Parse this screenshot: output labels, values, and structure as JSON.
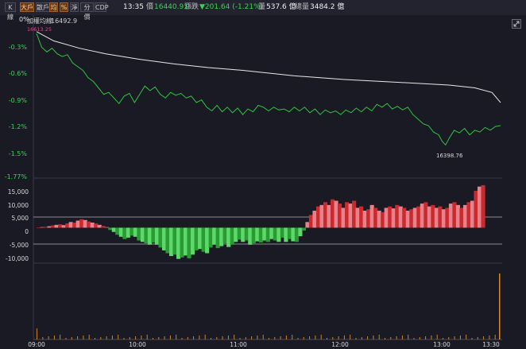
{
  "toolbar": {
    "buttons": [
      {
        "label": "K線",
        "active": false
      },
      {
        "label": "大戶",
        "active": true
      },
      {
        "label": "散戶",
        "active": false
      },
      {
        "label": "均",
        "active": true
      },
      {
        "label": "%",
        "active": true
      },
      {
        "label": "淨",
        "active": false
      },
      {
        "label": "分價",
        "active": false
      },
      {
        "label": "CDP",
        "active": false
      }
    ],
    "time": "13:35",
    "price_label": "價",
    "price": "16440.91",
    "change_label": "漲跌",
    "change": "▼201.64 (-1.21%)",
    "volume_label": "量",
    "volume": "537.6 億",
    "total_label": "總量",
    "total": "3484.2 億"
  },
  "price_panel": {
    "legend_name": "加權均線",
    "legend_value": "16492.9",
    "high_label": "16613.25",
    "low_label": "16398.76",
    "zero_label": "0%",
    "y_ticks": [
      "-0.3%",
      "-0.6%",
      "-0.9%",
      "-1.2%",
      "-1.5%",
      "-1.77%"
    ]
  },
  "flow_panel": {
    "y_ticks": [
      "15,000",
      "10,000",
      "5,000",
      "0",
      "-5,000",
      "-10,000"
    ]
  },
  "x_axis": {
    "ticks": [
      "09:00",
      "10:00",
      "11:00",
      "12:00",
      "13:00",
      "13:30"
    ]
  },
  "chart_data": {
    "type": "line",
    "title": "",
    "x_domain_minutes": [
      0,
      270
    ],
    "price_ylim_pct": [
      0,
      -1.77
    ],
    "average_line_pct": [
      [
        0,
        -0.18
      ],
      [
        10,
        -0.28
      ],
      [
        25,
        -0.36
      ],
      [
        40,
        -0.42
      ],
      [
        60,
        -0.48
      ],
      [
        80,
        -0.53
      ],
      [
        100,
        -0.57
      ],
      [
        120,
        -0.6
      ],
      [
        150,
        -0.66
      ],
      [
        180,
        -0.7
      ],
      [
        210,
        -0.73
      ],
      [
        240,
        -0.76
      ],
      [
        255,
        -0.79
      ],
      [
        265,
        -0.84
      ],
      [
        270,
        -0.95
      ]
    ],
    "index_line_pct": [
      [
        0,
        -0.2
      ],
      [
        3,
        -0.35
      ],
      [
        6,
        -0.4
      ],
      [
        9,
        -0.36
      ],
      [
        12,
        -0.42
      ],
      [
        15,
        -0.45
      ],
      [
        18,
        -0.43
      ],
      [
        21,
        -0.52
      ],
      [
        24,
        -0.56
      ],
      [
        27,
        -0.6
      ],
      [
        30,
        -0.68
      ],
      [
        33,
        -0.72
      ],
      [
        36,
        -0.79
      ],
      [
        39,
        -0.86
      ],
      [
        42,
        -0.84
      ],
      [
        45,
        -0.9
      ],
      [
        48,
        -0.96
      ],
      [
        51,
        -0.88
      ],
      [
        54,
        -0.85
      ],
      [
        57,
        -0.95
      ],
      [
        60,
        -0.86
      ],
      [
        63,
        -0.77
      ],
      [
        66,
        -0.82
      ],
      [
        69,
        -0.78
      ],
      [
        72,
        -0.86
      ],
      [
        75,
        -0.9
      ],
      [
        78,
        -0.84
      ],
      [
        81,
        -0.87
      ],
      [
        84,
        -0.85
      ],
      [
        87,
        -0.9
      ],
      [
        90,
        -0.88
      ],
      [
        93,
        -0.95
      ],
      [
        96,
        -0.92
      ],
      [
        99,
        -1.0
      ],
      [
        102,
        -1.04
      ],
      [
        105,
        -0.98
      ],
      [
        108,
        -1.05
      ],
      [
        111,
        -1.0
      ],
      [
        114,
        -1.06
      ],
      [
        117,
        -1.01
      ],
      [
        120,
        -1.08
      ],
      [
        123,
        -1.02
      ],
      [
        126,
        -1.05
      ],
      [
        129,
        -0.98
      ],
      [
        132,
        -1.0
      ],
      [
        135,
        -1.04
      ],
      [
        138,
        -1.0
      ],
      [
        141,
        -1.03
      ],
      [
        144,
        -1.02
      ],
      [
        147,
        -1.05
      ],
      [
        150,
        -1.0
      ],
      [
        153,
        -1.04
      ],
      [
        156,
        -1.0
      ],
      [
        159,
        -1.06
      ],
      [
        162,
        -1.02
      ],
      [
        165,
        -1.08
      ],
      [
        168,
        -1.03
      ],
      [
        171,
        -1.06
      ],
      [
        174,
        -1.04
      ],
      [
        177,
        -1.08
      ],
      [
        180,
        -1.03
      ],
      [
        183,
        -1.06
      ],
      [
        186,
        -1.01
      ],
      [
        189,
        -1.05
      ],
      [
        192,
        -1.0
      ],
      [
        195,
        -1.04
      ],
      [
        198,
        -0.97
      ],
      [
        201,
        -1.0
      ],
      [
        204,
        -0.96
      ],
      [
        207,
        -1.02
      ],
      [
        210,
        -0.99
      ],
      [
        213,
        -1.03
      ],
      [
        216,
        -1.0
      ],
      [
        219,
        -1.08
      ],
      [
        222,
        -1.13
      ],
      [
        225,
        -1.18
      ],
      [
        228,
        -1.2
      ],
      [
        231,
        -1.27
      ],
      [
        234,
        -1.3
      ],
      [
        236,
        -1.37
      ],
      [
        238,
        -1.41
      ],
      [
        240,
        -1.34
      ],
      [
        243,
        -1.25
      ],
      [
        246,
        -1.28
      ],
      [
        249,
        -1.23
      ],
      [
        252,
        -1.3
      ],
      [
        255,
        -1.25
      ],
      [
        258,
        -1.27
      ],
      [
        261,
        -1.22
      ],
      [
        264,
        -1.25
      ],
      [
        267,
        -1.21
      ],
      [
        270,
        -1.2
      ]
    ],
    "flow_ylim": [
      -12500,
      17500
    ],
    "flow_values": [
      0,
      200,
      300,
      500,
      800,
      1000,
      1200,
      900,
      1500,
      2000,
      1800,
      2500,
      3000,
      2700,
      2200,
      1800,
      1500,
      1000,
      600,
      200,
      -800,
      -1500,
      -2500,
      -3200,
      -4000,
      -3500,
      -2800,
      -3200,
      -4500,
      -5000,
      -5500,
      -6000,
      -5200,
      -6000,
      -7000,
      -8000,
      -9000,
      -10000,
      -9500,
      -11000,
      -10500,
      -9800,
      -10800,
      -9500,
      -8000,
      -7500,
      -8500,
      -9000,
      -7000,
      -6000,
      -7200,
      -6500,
      -5500,
      -6800,
      -6000,
      -5000,
      -4200,
      -5000,
      -4500,
      -6000,
      -5500,
      -4800,
      -5200,
      -4500,
      -5000,
      -4000,
      -4500,
      -5000,
      -3500,
      -5000,
      -4000,
      -4800,
      -5000,
      -3000,
      -1000,
      2000,
      4500,
      6000,
      7500,
      8000,
      9000,
      8000,
      10000,
      9500,
      8500,
      7000,
      9000,
      8500,
      9500,
      7000,
      7500,
      6000,
      6500,
      8000,
      7000,
      6000,
      5500,
      7000,
      7500,
      6800,
      8000,
      7500,
      7000,
      6000,
      6500,
      7000,
      7500,
      8500,
      9000,
      7500,
      8000,
      7000,
      7500,
      6500,
      7000,
      8500,
      9000,
      8000,
      7000,
      8000,
      9000,
      9500,
      13000,
      14500,
      15000
    ]
  }
}
